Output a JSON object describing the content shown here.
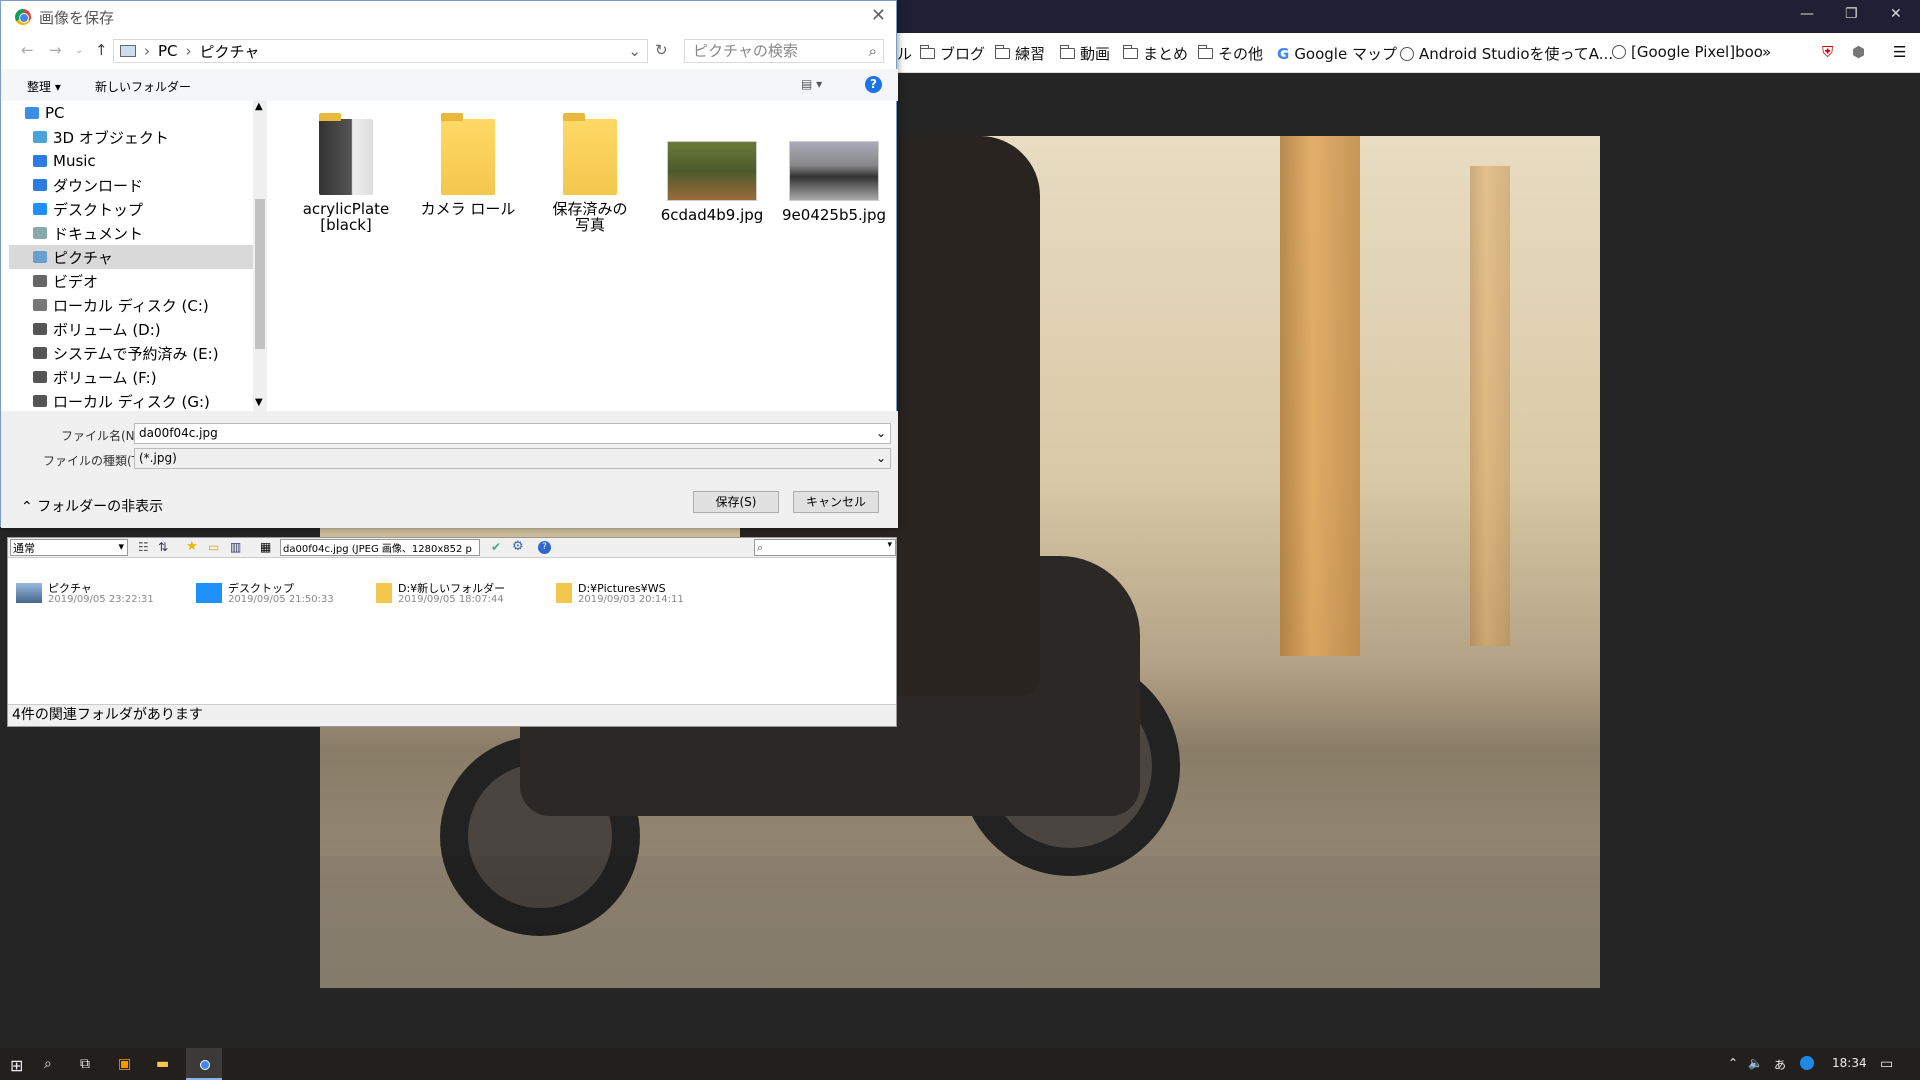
{
  "browser": {
    "bookmarks": [
      {
        "label": "ル",
        "type": "text"
      },
      {
        "label": "ブログ",
        "type": "folder"
      },
      {
        "label": "練習",
        "type": "folder"
      },
      {
        "label": "動画",
        "type": "folder"
      },
      {
        "label": "まとめ",
        "type": "folder"
      },
      {
        "label": "その他",
        "type": "folder"
      },
      {
        "label": "Google マップ",
        "type": "google"
      },
      {
        "label": "Android Studioを使ってA...",
        "type": "globe"
      },
      {
        "label": "[Google Pixel]boo",
        "type": "globe"
      }
    ],
    "overflow": "»"
  },
  "dialog": {
    "title": "画像を保存",
    "breadcrumb": [
      "PC",
      "ピクチャ"
    ],
    "search_placeholder": "ピクチャの検索",
    "organize": "整理 ▾",
    "new_folder": "新しいフォルダー",
    "nav_items": [
      {
        "label": "PC",
        "color": "#3a8ee6",
        "selected": false
      },
      {
        "label": "3D オブジェクト",
        "color": "#4aa3d8",
        "selected": false
      },
      {
        "label": "Music",
        "color": "#2d7be0",
        "selected": false
      },
      {
        "label": "ダウンロード",
        "color": "#2d7be0",
        "selected": false
      },
      {
        "label": "デスクトップ",
        "color": "#1e90ff",
        "selected": false
      },
      {
        "label": "ドキュメント",
        "color": "#8aa",
        "selected": false
      },
      {
        "label": "ピクチャ",
        "color": "#6aa0d0",
        "selected": true
      },
      {
        "label": "ビデオ",
        "color": "#666",
        "selected": false
      },
      {
        "label": "ローカル ディスク (C:)",
        "color": "#777",
        "selected": false
      },
      {
        "label": "ボリューム (D:)",
        "color": "#555",
        "selected": false
      },
      {
        "label": "システムで予約済み (E:)",
        "color": "#555",
        "selected": false
      },
      {
        "label": "ボリューム (F:)",
        "color": "#555",
        "selected": false
      },
      {
        "label": "ローカル ディスク (G:)",
        "color": "#555",
        "selected": false
      }
    ],
    "files": [
      {
        "name": "acrylicPlate\n[black]",
        "kind": "folder-dark"
      },
      {
        "name": "カメラ ロール",
        "kind": "folder"
      },
      {
        "name": "保存済みの\n写真",
        "kind": "folder"
      },
      {
        "name": "6cdad4b9.jpg",
        "kind": "image-green"
      },
      {
        "name": "9e0425b5.jpg",
        "kind": "image-bike"
      }
    ],
    "filename_label": "ファイル名(N):",
    "filename": "da00f04c.jpg",
    "filetype_label": "ファイルの種類(T):",
    "filetype": "(*.jpg)",
    "hide_folders": "フォルダーの非表示",
    "save": "保存(S)",
    "cancel": "キャンセル"
  },
  "helper": {
    "mode": "通常",
    "file_info": "da00f04c.jpg (JPEG 画像、1280x852 p",
    "items": [
      {
        "name": "ピクチャ",
        "date": "2019/09/05 23:22:31"
      },
      {
        "name": "デスクトップ",
        "date": "2019/09/05 21:50:33"
      },
      {
        "name": "D:¥新しいフォルダー",
        "date": "2019/09/05 18:07:44"
      },
      {
        "name": "D:¥Pictures¥WS",
        "date": "2019/09/03 20:14:11"
      }
    ],
    "status": "4件の関連フォルダがあります"
  },
  "taskbar": {
    "time": "18:34",
    "ime": "あ"
  }
}
